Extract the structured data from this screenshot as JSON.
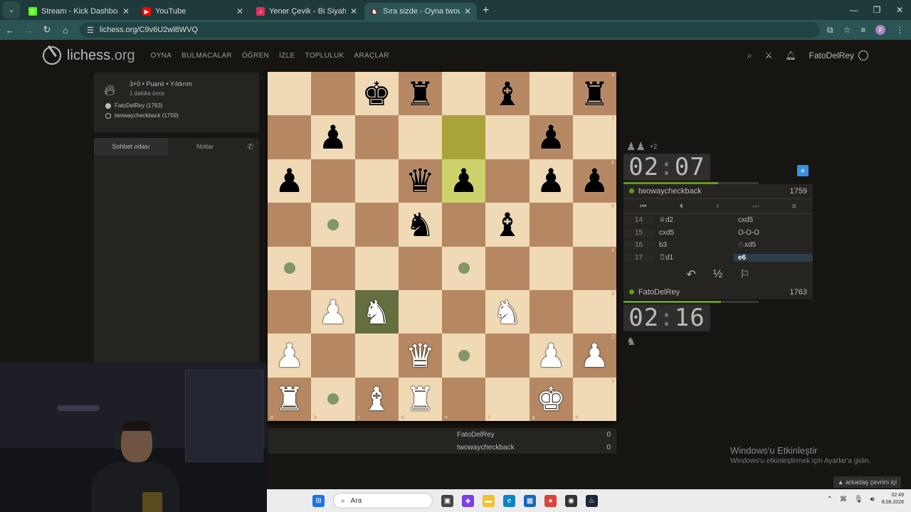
{
  "browser": {
    "tabs": [
      {
        "title": "Stream - Kick Dashboard",
        "icon": "kick-icon",
        "color": "#53fc18",
        "glyph": "K"
      },
      {
        "title": "YouTube",
        "icon": "youtube-icon",
        "color": "#ff0000",
        "glyph": "▶"
      },
      {
        "title": "Yener Çevik - Bi Siyah Bi Be",
        "icon": "music-icon",
        "color": "#e03060",
        "glyph": "♪"
      },
      {
        "title": "Sıra sizde - Oyna twowaycheckt",
        "icon": "lichess-tab-icon",
        "color": "#444444",
        "glyph": "♞"
      }
    ],
    "new_tab": "+",
    "url": "lichess.org/C9v6U2wl8WVQ"
  },
  "site": {
    "logo": {
      "main": "lichess",
      "suffix": ".org"
    },
    "nav": [
      "OYNA",
      "BULMACALAR",
      "ÖĞREN",
      "İZLE",
      "TOPLULUK",
      "ARAÇLAR"
    ],
    "username": "FatoDelRey"
  },
  "game_info": {
    "mode": "3+0 • Puanlı • Yıldırım",
    "time_ago": "1 dakika önce",
    "white_player": "FatoDelRey (1763)",
    "black_player": "twowaycheckback (1759)"
  },
  "chat": {
    "tab_room": "Sohbet odası",
    "tab_notes": "Notlar"
  },
  "board": {
    "ranks": [
      "8",
      "7",
      "6",
      "5",
      "4",
      "3",
      "2",
      "1"
    ],
    "files": [
      "a",
      "b",
      "c",
      "d",
      "e",
      "f",
      "g",
      "h"
    ],
    "position": [
      [
        "",
        "",
        "bK",
        "bR",
        "",
        "bB",
        "",
        "bR"
      ],
      [
        "",
        "bP",
        "",
        "",
        "",
        "",
        "bP",
        ""
      ],
      [
        "bP",
        "",
        "",
        "bQ",
        "bP",
        "",
        "bP",
        "bP"
      ],
      [
        "",
        "",
        "",
        "bN",
        "",
        "bB",
        "",
        ""
      ],
      [
        "",
        "",
        "",
        "",
        "",
        "",
        "",
        ""
      ],
      [
        "",
        "wP",
        "wN",
        "",
        "",
        "wN",
        "",
        ""
      ],
      [
        "wP",
        "",
        "",
        "wQ",
        "",
        "",
        "wP",
        "wP"
      ],
      [
        "wR",
        "",
        "wB",
        "wR",
        "",
        "",
        "wK",
        ""
      ]
    ],
    "last_move": [
      "e7",
      "e6"
    ],
    "selected": "c3",
    "move_dots": [
      "b5",
      "a4",
      "e4",
      "e2",
      "b1"
    ]
  },
  "score": {
    "rows": [
      {
        "name": "FatoDelRey",
        "score": "0"
      },
      {
        "name": "twowaycheckback",
        "score": "0"
      }
    ]
  },
  "opponent": {
    "captured": "♟♟",
    "captured_diff": "+2",
    "clock_min": "02",
    "clock_sec": "07",
    "time_fraction": 0.7,
    "name": "twowaycheckback",
    "rating": "1759"
  },
  "player": {
    "captured": "♞",
    "clock_min": "02",
    "clock_sec": "16",
    "time_fraction": 0.72,
    "name": "FatoDelRey",
    "rating": "1763"
  },
  "moves": [
    {
      "no": "14",
      "w": "♕d2",
      "b": "cxd5"
    },
    {
      "no": "15",
      "w": "cxd5",
      "b": "O-O-O"
    },
    {
      "no": "16",
      "w": "b3",
      "b": "♘xd5"
    },
    {
      "no": "17",
      "w": "♖d1",
      "b": "e6"
    }
  ],
  "current_move": "e6",
  "game_controls": {
    "takeback": "↶",
    "draw": "½",
    "resign": "⚐"
  },
  "windows": {
    "activate_title": "Windows'u Etkinleştir",
    "activate_sub": "Windows'u etkinleştirmek için Ayarlar'a gidin.",
    "friends": "▲ arkadaş çevrim içi",
    "search_placeholder": "Ara",
    "time": "02:49",
    "date": "8.08.2026"
  }
}
